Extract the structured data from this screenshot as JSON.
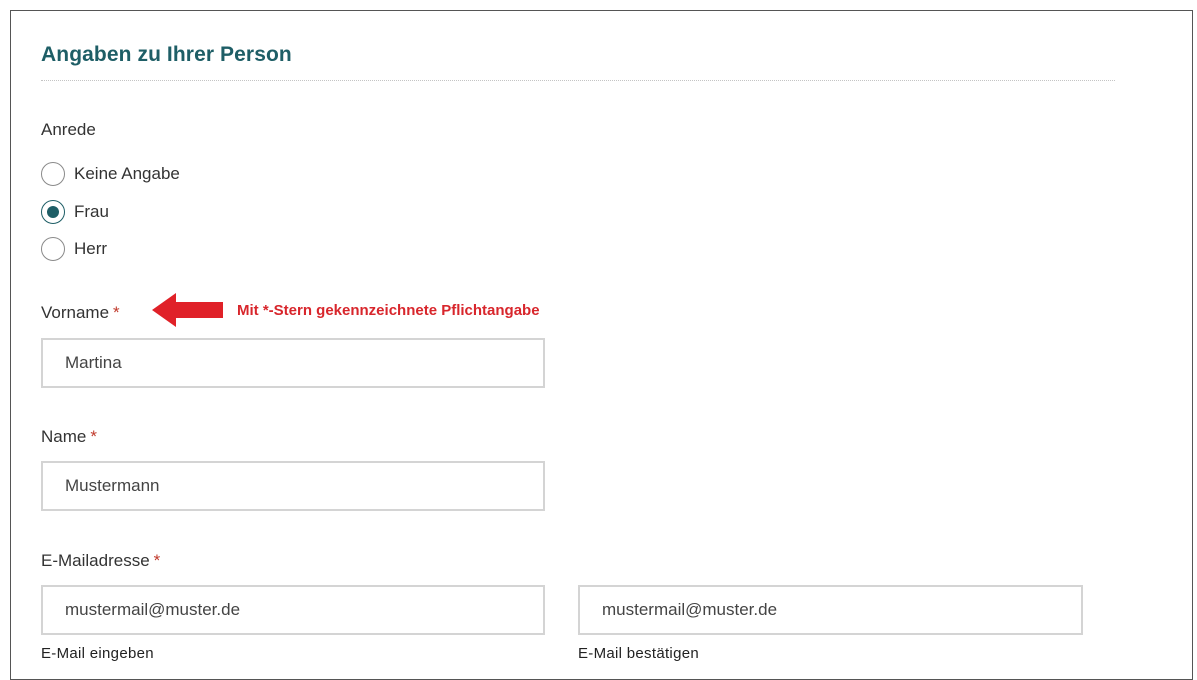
{
  "section": {
    "title": "Angaben zu Ihrer Person"
  },
  "salutation": {
    "label": "Anrede",
    "options": [
      {
        "label": "Keine Angabe",
        "checked": false
      },
      {
        "label": "Frau",
        "checked": true
      },
      {
        "label": "Herr",
        "checked": false
      }
    ]
  },
  "annotation": {
    "text": "Mit *-Stern gekennzeichnete Pflichtangabe",
    "color": "#d8262c"
  },
  "required_marker": "*",
  "fields": {
    "first_name": {
      "label": "Vorname",
      "value": "Martina"
    },
    "last_name": {
      "label": "Name",
      "value": "Mustermann"
    },
    "email": {
      "label": "E-Mailadresse",
      "value": "mustermail@muster.de",
      "hint": "E-Mail eingeben",
      "confirm_value": "mustermail@muster.de",
      "confirm_hint": "E-Mail bestätigen"
    }
  },
  "colors": {
    "accent": "#1e5e66",
    "required": "#c0392b",
    "input_border": "#d4d4d4"
  }
}
